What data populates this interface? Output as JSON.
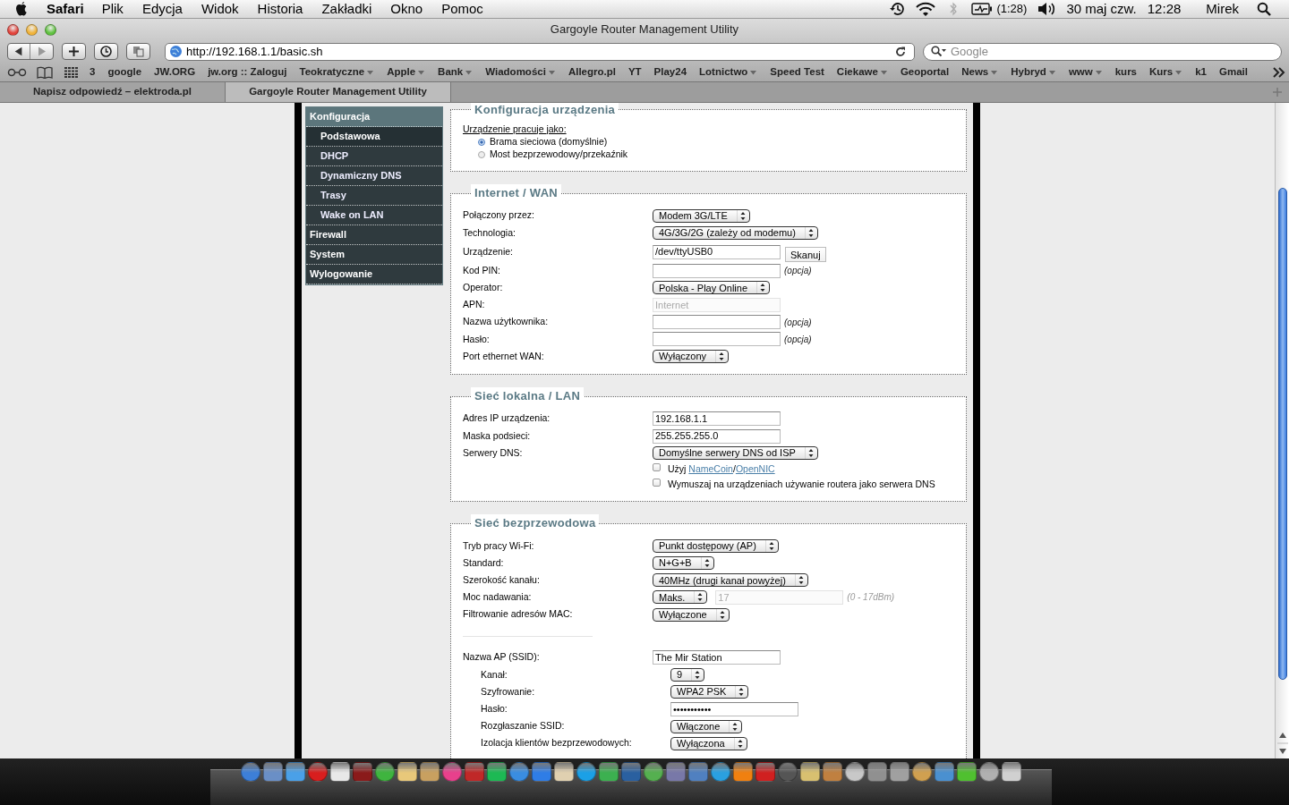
{
  "menu_bar": {
    "app": "Safari",
    "menus": [
      "Plik",
      "Edycja",
      "Widok",
      "Historia",
      "Zakładki",
      "Okno",
      "Pomoc"
    ],
    "battery": "(1:28)",
    "date": "30 maj czw.",
    "time": "12:28",
    "user": "Mirek"
  },
  "window": {
    "title": "Gargoyle Router Management Utility"
  },
  "toolbar": {
    "url": "http://192.168.1.1/basic.sh",
    "search": {
      "placeholder": "Google"
    }
  },
  "bookmarks": [
    {
      "label": "3",
      "menu": false
    },
    {
      "label": "google",
      "menu": false
    },
    {
      "label": "JW.ORG",
      "menu": false
    },
    {
      "label": "jw.org :: Zaloguj",
      "menu": false
    },
    {
      "label": "Teokratyczne",
      "menu": true
    },
    {
      "label": "Apple",
      "menu": true
    },
    {
      "label": "Bank",
      "menu": true
    },
    {
      "label": "Wiadomości",
      "menu": true
    },
    {
      "label": "Allegro.pl",
      "menu": false
    },
    {
      "label": "YT",
      "menu": false
    },
    {
      "label": "Play24",
      "menu": false
    },
    {
      "label": "Lotnictwo",
      "menu": true
    },
    {
      "label": "Speed Test",
      "menu": false
    },
    {
      "label": "Ciekawe",
      "menu": true
    },
    {
      "label": "Geoportal",
      "menu": false
    },
    {
      "label": "News",
      "menu": true
    },
    {
      "label": "Hybryd",
      "menu": true
    },
    {
      "label": "www",
      "menu": true
    },
    {
      "label": "kurs",
      "menu": false
    },
    {
      "label": "Kurs",
      "menu": true
    },
    {
      "label": "k1",
      "menu": false
    },
    {
      "label": "Gmail",
      "menu": false
    }
  ],
  "tabs": [
    {
      "label": "Napisz odpowiedź – elektroda.pl",
      "selected": false
    },
    {
      "label": "Gargoyle Router Management Utility",
      "selected": true
    }
  ],
  "sidebar": {
    "items": [
      {
        "label": "Konfiguracja",
        "selected": false,
        "children": [
          {
            "label": "Podstawowa",
            "selected": true
          },
          {
            "label": "DHCP",
            "selected": false
          },
          {
            "label": "Dynamiczny DNS",
            "selected": false
          },
          {
            "label": "Trasy",
            "selected": false
          },
          {
            "label": "Wake on LAN",
            "selected": false
          }
        ]
      },
      {
        "label": "Firewall",
        "selected": false
      },
      {
        "label": "System",
        "selected": false
      },
      {
        "label": "Wylogowanie",
        "selected": false
      }
    ]
  },
  "sections": [
    {
      "legend": "Konfiguracja urządzenia",
      "kind": "radios",
      "prompt": "Urządzenie pracuje jako:",
      "options": [
        {
          "label": "Brama sieciowa (domyślnie)",
          "selected": true
        },
        {
          "label": "Most bezprzewodowy/przekaźnik",
          "selected": false
        }
      ]
    },
    {
      "legend": "Internet / WAN",
      "kind": "form",
      "row_groups": [
        [
          {
            "label": "Połączony przez:",
            "controls": [
              {
                "kind": "select",
                "value": "Modem 3G/LTE"
              }
            ]
          },
          {
            "label": "Technologia:",
            "controls": [
              {
                "kind": "select",
                "value": "4G/3G/2G (zależy od modemu)"
              }
            ]
          },
          {
            "label": "Urządzenie:",
            "controls": [
              {
                "kind": "input",
                "value": "/dev/ttyUSB0",
                "disabled": false
              },
              {
                "kind": "button",
                "value": "Skanuj"
              }
            ]
          },
          {
            "label": "Kod PIN:",
            "controls": [
              {
                "kind": "input",
                "disabled": false
              },
              {
                "kind": "hint",
                "value": "(opcja)",
                "disabled": false
              }
            ]
          },
          {
            "label": "Operator:",
            "controls": [
              {
                "kind": "select",
                "value": "Polska - Play Online"
              }
            ]
          },
          {
            "label": "APN:",
            "controls": [
              {
                "kind": "input",
                "value": "Internet",
                "disabled": true
              }
            ]
          },
          {
            "label": "Nazwa użytkownika:",
            "controls": [
              {
                "kind": "input",
                "disabled": false
              },
              {
                "kind": "hint",
                "value": "(opcja)",
                "disabled": false
              }
            ]
          },
          {
            "label": "Hasło:",
            "controls": [
              {
                "kind": "input",
                "disabled": false
              },
              {
                "kind": "hint",
                "value": "(opcja)",
                "disabled": false
              }
            ]
          },
          {
            "label": "Port ethernet WAN:",
            "controls": [
              {
                "kind": "select",
                "value": "Wyłączony"
              }
            ]
          }
        ]
      ]
    },
    {
      "legend": "Sieć lokalna / LAN",
      "kind": "form",
      "row_groups": [
        [
          {
            "label": "Adres IP urządzenia:",
            "controls": [
              {
                "kind": "input",
                "value": "192.168.1.1",
                "disabled": false
              }
            ]
          },
          {
            "label": "Maska podsieci:",
            "controls": [
              {
                "kind": "input",
                "value": "255.255.255.0",
                "disabled": false
              }
            ]
          },
          {
            "label": "Serwery DNS:",
            "controls": [
              {
                "kind": "select",
                "value": "Domyślne serwery DNS od ISP"
              }
            ]
          },
          {
            "controls": [
              {
                "kind": "checkbox",
                "checked": false,
                "parts": [
                  {
                    "text": "Użyj ",
                    "link": false
                  },
                  {
                    "text": "NameCoin",
                    "link": true
                  },
                  {
                    "text": "/",
                    "link": false
                  },
                  {
                    "text": "OpenNIC",
                    "link": true
                  }
                ]
              }
            ]
          },
          {
            "controls": [
              {
                "kind": "checkbox",
                "checked": false,
                "parts": [
                  {
                    "text": "Wymuszaj na urządzeniach używanie routera jako serwera DNS",
                    "link": false
                  }
                ]
              }
            ]
          }
        ]
      ]
    },
    {
      "legend": "Sieć bezprzewodowa",
      "kind": "form",
      "row_groups": [
        [
          {
            "label": "Tryb pracy Wi-Fi:",
            "controls": [
              {
                "kind": "select",
                "value": "Punkt dostępowy (AP)"
              }
            ]
          },
          {
            "label": "Standard:",
            "controls": [
              {
                "kind": "select",
                "value": "N+G+B"
              }
            ]
          },
          {
            "label": "Szerokość kanału:",
            "controls": [
              {
                "kind": "select",
                "value": "40MHz (drugi kanał powyżej)"
              }
            ]
          },
          {
            "label": "Moc nadawania:",
            "controls": [
              {
                "kind": "select",
                "value": "Maks."
              },
              {
                "kind": "input",
                "value": "17",
                "disabled": true
              },
              {
                "kind": "hint",
                "value": "(0 - 17dBm)",
                "disabled": true
              }
            ]
          },
          {
            "label": "Filtrowanie adresów MAC:",
            "controls": [
              {
                "kind": "select",
                "value": "Wyłączone"
              }
            ]
          }
        ],
        [
          {
            "label": "Nazwa AP (SSID):",
            "controls": [
              {
                "kind": "input",
                "value": "The Mir Station",
                "disabled": false
              }
            ],
            "children": [
              {
                "label": "Kanał:",
                "controls": [
                  {
                    "kind": "select",
                    "value": "9"
                  }
                ]
              },
              {
                "label": "Szyfrowanie:",
                "controls": [
                  {
                    "kind": "select",
                    "value": "WPA2 PSK"
                  }
                ]
              },
              {
                "label": "Hasło:",
                "controls": [
                  {
                    "kind": "input",
                    "value": "•••••••••••",
                    "disabled": false
                  }
                ]
              },
              {
                "label": "Rozgłaszanie SSID:",
                "controls": [
                  {
                    "kind": "select",
                    "value": "Włączone"
                  }
                ]
              },
              {
                "label": "Izolacja klientów bezprzewodowych:",
                "controls": [
                  {
                    "kind": "select",
                    "value": "Wyłączona"
                  }
                ]
              }
            ]
          }
        ]
      ]
    }
  ]
}
